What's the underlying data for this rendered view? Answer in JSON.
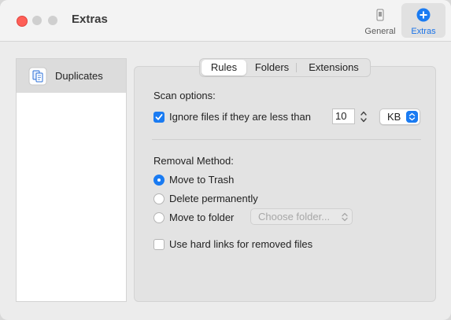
{
  "window": {
    "title": "Extras",
    "toolbar": {
      "general_label": "General",
      "extras_label": "Extras"
    }
  },
  "sidebar": {
    "items": [
      {
        "label": "Duplicates"
      }
    ]
  },
  "tabs": {
    "items": [
      "Rules",
      "Folders",
      "Extensions"
    ],
    "selected": "Rules"
  },
  "scan": {
    "heading": "Scan options:",
    "ignore_label": "Ignore files if they are less than",
    "ignore_checked": true,
    "size_value": "10",
    "unit": "KB"
  },
  "removal": {
    "heading": "Removal Method:",
    "options": [
      {
        "label": "Move to Trash",
        "selected": true
      },
      {
        "label": "Delete permanently",
        "selected": false
      },
      {
        "label": "Move to folder",
        "selected": false
      }
    ],
    "folder_placeholder": "Choose folder...",
    "hard_links_label": "Use hard links for removed files",
    "hard_links_checked": false
  },
  "colors": {
    "accent": "#1a7bf2",
    "close_button": "#fe5f57"
  },
  "icons": {
    "general": "phone-settings-icon",
    "extras": "plus-circle-icon",
    "duplicates": "duplicate-documents-icon"
  }
}
